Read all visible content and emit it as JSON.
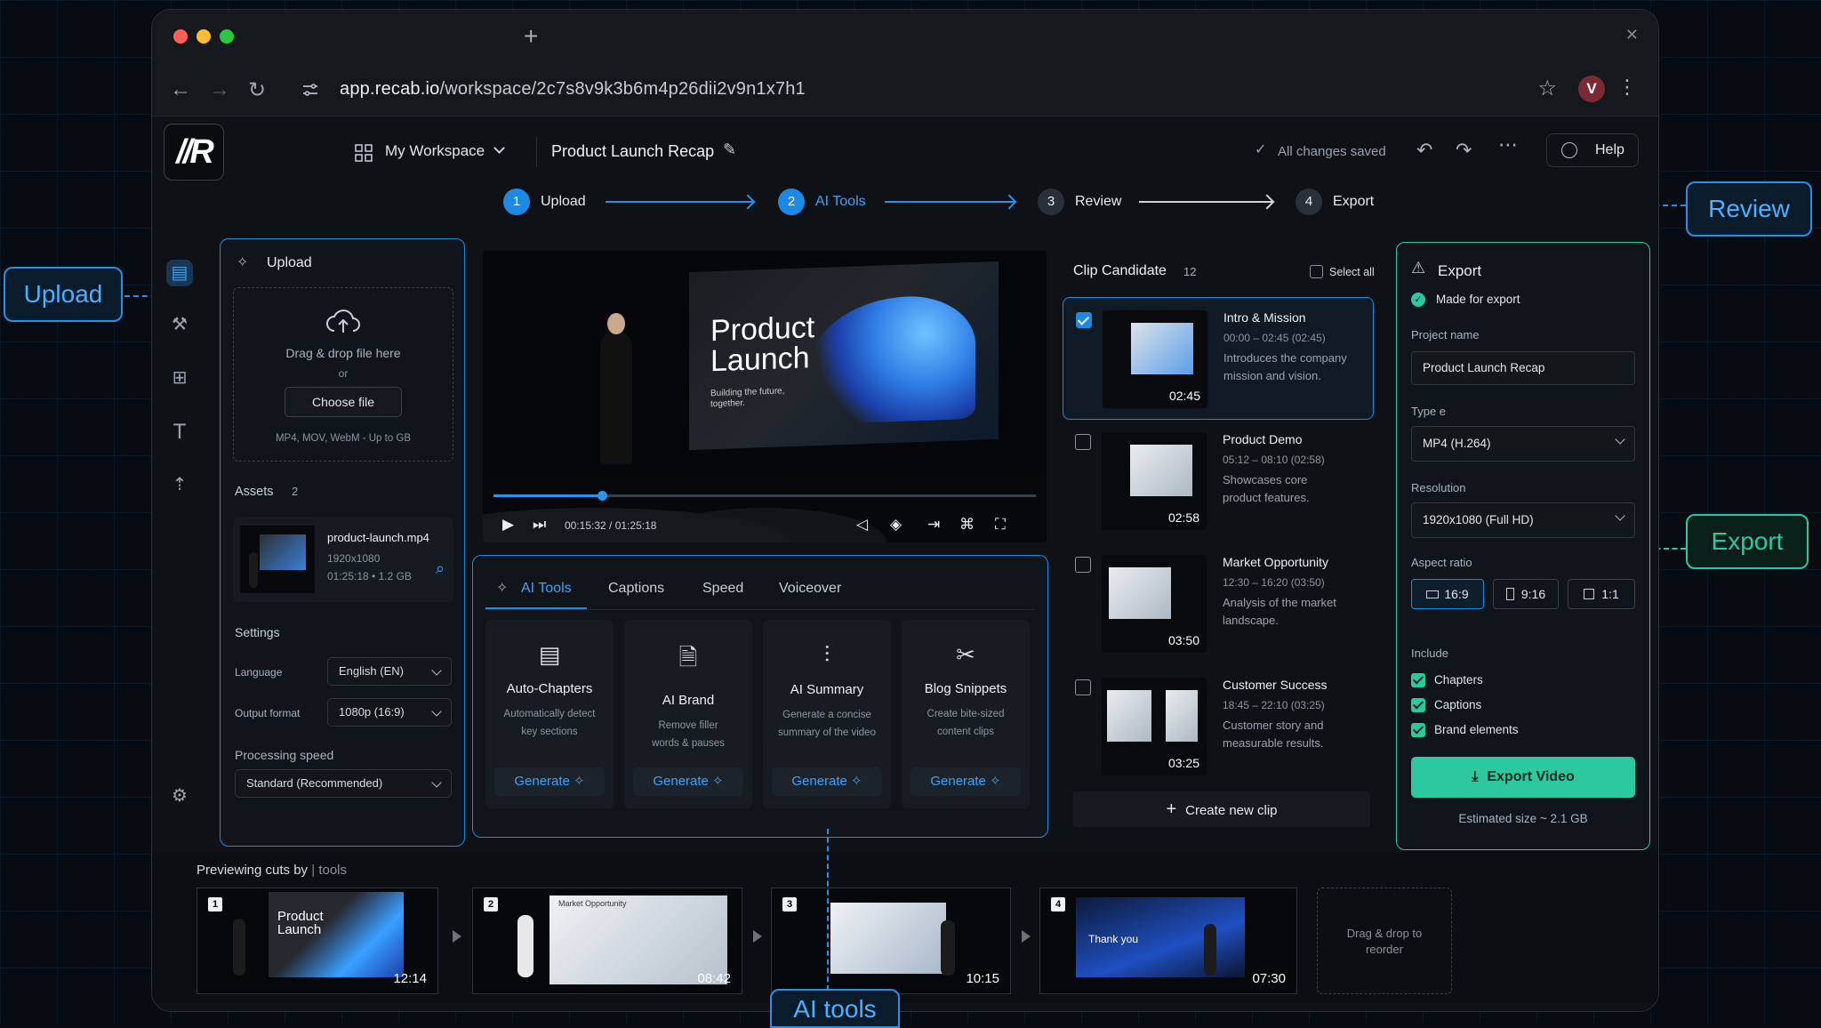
{
  "browser": {
    "url_host": "app.recab.io",
    "url_path": "/workspace/2c7s8v9k3b6m4p26dii2v9n1x7h1",
    "avatar": "V",
    "new_tab": "+"
  },
  "header": {
    "logo": "//R",
    "workspace": "My Workspace",
    "project": "Product Launch Recap",
    "saved": "All changes saved",
    "help": "Help"
  },
  "steps": [
    {
      "n": "1",
      "label": "Upload"
    },
    {
      "n": "2",
      "label": "AI Tools"
    },
    {
      "n": "3",
      "label": "Review"
    },
    {
      "n": "4",
      "label": "Export"
    }
  ],
  "upload": {
    "title": "Upload",
    "drop": "Drag & drop file here",
    "or": "or",
    "choose": "Choose file",
    "formats": "MP4, MOV, WebM - Up to GB",
    "assets_label": "Assets",
    "assets_count": "2",
    "asset": {
      "name": "product-launch.mp4",
      "res": "1920x1080",
      "meta": "01:25:18 • 1.2 GB"
    },
    "settings_label": "Settings",
    "language_label": "Language",
    "language": "English (EN)",
    "format_label": "Output format",
    "format": "1080p (16:9)",
    "speed_label": "Processing speed",
    "speed": "Standard (Recommended)"
  },
  "video": {
    "screen_title1": "Product",
    "screen_title2": "Launch",
    "screen_sub1": "Building the future,",
    "screen_sub2": "together.",
    "time": "00:15:32 / 01:25:18",
    "progress": 0.2
  },
  "tools": {
    "tabs": [
      "AI Tools",
      "Captions",
      "Speed",
      "Voiceover"
    ],
    "cards": [
      {
        "title": "Auto-Chapters",
        "d1": "Automatically detect",
        "d2": "key sections",
        "btn": "Generate"
      },
      {
        "title": "AI Brand",
        "d1": "Remove filler",
        "d2": "words & pauses",
        "btn": "Generate"
      },
      {
        "title": "AI Summary",
        "d1": "Generate a concise",
        "d2": "summary of the video",
        "btn": "Generate"
      },
      {
        "title": "Blog Snippets",
        "d1": "Create bite-sized",
        "d2": "content clips",
        "btn": "Generate"
      }
    ]
  },
  "clips": {
    "title": "Clip Candidate",
    "count": "12",
    "select_all": "Select all",
    "create": "Create new clip",
    "items": [
      {
        "title": "Intro & Mission",
        "time": "00:00 – 02:45 (02:45)",
        "d1": "Introduces the company",
        "d2": "mission and vision.",
        "dur": "02:45",
        "checked": true
      },
      {
        "title": "Product Demo",
        "time": "05:12 – 08:10 (02:58)",
        "d1": "Showcases core",
        "d2": "product features.",
        "dur": "02:58",
        "checked": false
      },
      {
        "title": "Market Opportunity",
        "time": "12:30 – 16:20 (03:50)",
        "d1": "Analysis of the market",
        "d2": "landscape.",
        "dur": "03:50",
        "checked": false
      },
      {
        "title": "Customer Success",
        "time": "18:45 – 22:10 (03:25)",
        "d1": "Customer story and",
        "d2": "measurable results.",
        "dur": "03:25",
        "checked": false
      }
    ]
  },
  "export": {
    "title": "Export",
    "ready": "Made for export",
    "name_label": "Project name",
    "name": "Product Launch Recap",
    "type_label": "Type e",
    "type": "MP4 (H.264)",
    "res_label": "Resolution",
    "res": "1920x1080 (Full HD)",
    "ar_label": "Aspect ratio",
    "ar": [
      "16:9",
      "9:16",
      "1:1"
    ],
    "include_label": "Include",
    "include": [
      "Chapters",
      "Captions",
      "Brand elements"
    ],
    "button": "Export Video",
    "estimate": "Estimated size ~ 2.1 GB"
  },
  "strip": {
    "label": "Previewing cuts by",
    "label2": "tools",
    "frames": [
      {
        "n": "1",
        "dur": "12:14",
        "t1": "Product",
        "t2": "Launch"
      },
      {
        "n": "2",
        "dur": "08:42",
        "t1": "Market Opportunity"
      },
      {
        "n": "3",
        "dur": "10:15"
      },
      {
        "n": "4",
        "dur": "07:30",
        "t1": "Thank you"
      }
    ],
    "drop1": "Drag & drop to",
    "drop2": "reorder"
  },
  "callouts": {
    "upload": "Upload",
    "review": "Review",
    "export": "Export",
    "tools": "AI tools"
  },
  "colors": {
    "accent": "#1e88e5",
    "teal": "#2cc9a0",
    "bg": "#0e1216"
  }
}
